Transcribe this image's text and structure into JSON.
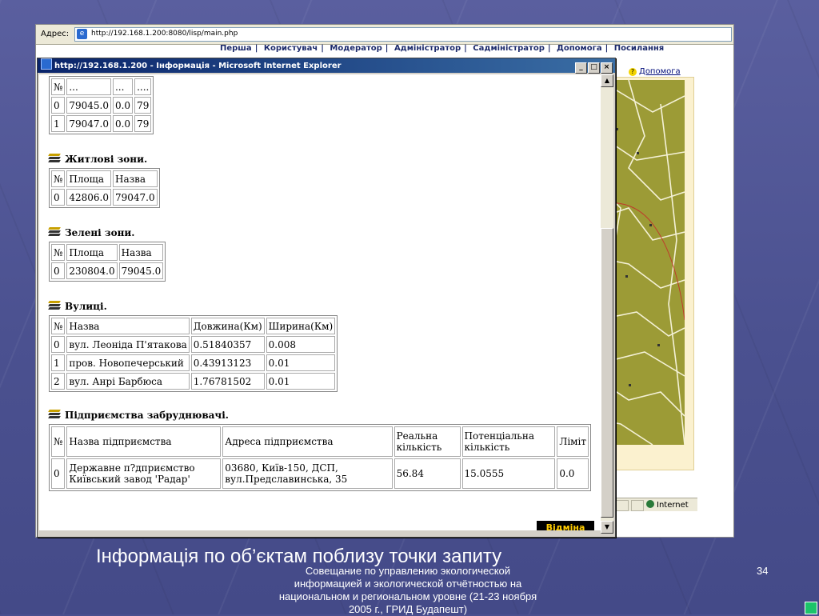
{
  "colors": {
    "slide_bg": "#4a4f8e",
    "titlebar": "#0a246a",
    "map": "#9c9b36",
    "cancel_bg": "#000000",
    "cancel_text": "#ffcc00"
  },
  "browser": {
    "address_label": "Адрес:",
    "address_url": "http://192.168.1.200:8080/lisp/main.php",
    "nav_items": [
      "Перша",
      "Користувач",
      "Модератор",
      "Адміністратор",
      "Садміністратор",
      "Допомога",
      "Посилання"
    ],
    "help_link": "Допомога",
    "status_zone": "Internet"
  },
  "popup": {
    "title": "http://192.168.1.200 - Інформація - Microsoft Internet Explorer",
    "minimize": "_",
    "maximize": "□",
    "close": "×",
    "top_table": {
      "header": [
        "№",
        "...",
        "...",
        "...."
      ],
      "rows": [
        [
          "0",
          "79045.0",
          "0.0",
          "79"
        ],
        [
          "1",
          "79047.0",
          "0.0",
          "79"
        ]
      ]
    },
    "residential": {
      "title": "Житлові зони",
      "header": [
        "№",
        "Площа",
        "Назва"
      ],
      "rows": [
        [
          "0",
          "42806.0",
          "79047.0"
        ]
      ]
    },
    "green": {
      "title": "Зелені зони",
      "header": [
        "№",
        "Площа",
        "Назва"
      ],
      "rows": [
        [
          "0",
          "230804.0",
          "79045.0"
        ]
      ]
    },
    "streets": {
      "title": "Вулиці",
      "header": [
        "№",
        "Назва",
        "Довжина(Км)",
        "Ширина(Км)"
      ],
      "rows": [
        [
          "0",
          "вул. Леоніда П'ятакова",
          "0.51840357",
          "0.008"
        ],
        [
          "1",
          "пров. Новопечерський",
          "0.43913123",
          "0.01"
        ],
        [
          "2",
          "вул. Анрі Барбюса",
          "1.76781502",
          "0.01"
        ]
      ]
    },
    "polluters": {
      "title": "Підприємства забруднювачі",
      "header": [
        "№",
        "Назва підприємства",
        "Адреса підприємства",
        "Реальна кількість",
        "Потенціальна кількість",
        "Ліміт"
      ],
      "rows": [
        [
          "0",
          "Державне п?дприємство Київський завод 'Радар'",
          "03680, Київ-150, ДСП, вул.Предславинська, 35",
          "56.84",
          "15.0555",
          "0.0"
        ]
      ]
    },
    "cancel_label": "Відміна"
  },
  "slide": {
    "caption": "Інформація по об’єктам поблизу точки запиту",
    "footer": "Совещание по управлению экологической информацией и экологической отчётностью на национальном и региональном уровне (21-23 ноября 2005 г., ГРИД Будапешт)",
    "page_number": "34"
  }
}
